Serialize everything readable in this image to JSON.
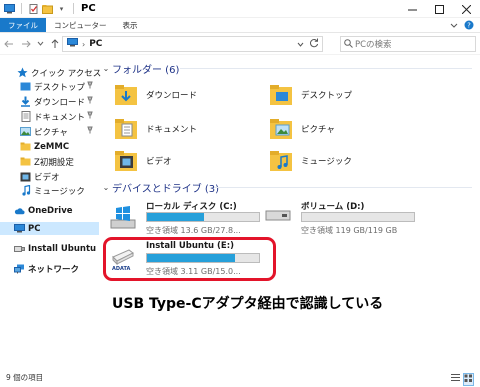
{
  "window": {
    "title": "PC"
  },
  "ribbon": {
    "tabs": [
      "ファイル",
      "コンピューター",
      "表示"
    ]
  },
  "address": {
    "crumb": "PC"
  },
  "search": {
    "placeholder": "PCの検索"
  },
  "nav": {
    "quick_access": "クイック アクセス",
    "pinned": [
      "デスクトップ",
      "ダウンロード",
      "ドキュメント",
      "ピクチャ"
    ],
    "folders": [
      "ZeMMC",
      "Z初期設定",
      "ビデオ",
      "ミュージック"
    ],
    "onedrive": "OneDrive",
    "pc": "PC",
    "install": "Install Ubuntu",
    "network": "ネットワーク"
  },
  "content": {
    "folders_header": "フォルダー (6)",
    "folders": [
      "ダウンロード",
      "デスクトップ",
      "ドキュメント",
      "ピクチャ",
      "ビデオ",
      "ミュージック"
    ],
    "drives_header": "デバイスとドライブ (3)",
    "drives": [
      {
        "name": "ローカル ディスク (C:)",
        "free": "空き領域 13.6 GB/27.8...",
        "used_fraction": 0.51
      },
      {
        "name": "ボリューム (D:)",
        "free": "空き領域 119 GB/119 GB",
        "used_fraction": 0.0
      },
      {
        "name": "Install Ubuntu (E:)",
        "free": "空き領域 3.11 GB/15.0...",
        "used_fraction": 0.79
      }
    ],
    "annotation": "USB Type-Cアダプタ経由で認識している"
  },
  "status": {
    "count": "9 個の項目"
  },
  "colors": {
    "accent": "#1979ca",
    "bar": "#26a0da",
    "highlight": "#e3142a",
    "folder": "#f4c342"
  }
}
